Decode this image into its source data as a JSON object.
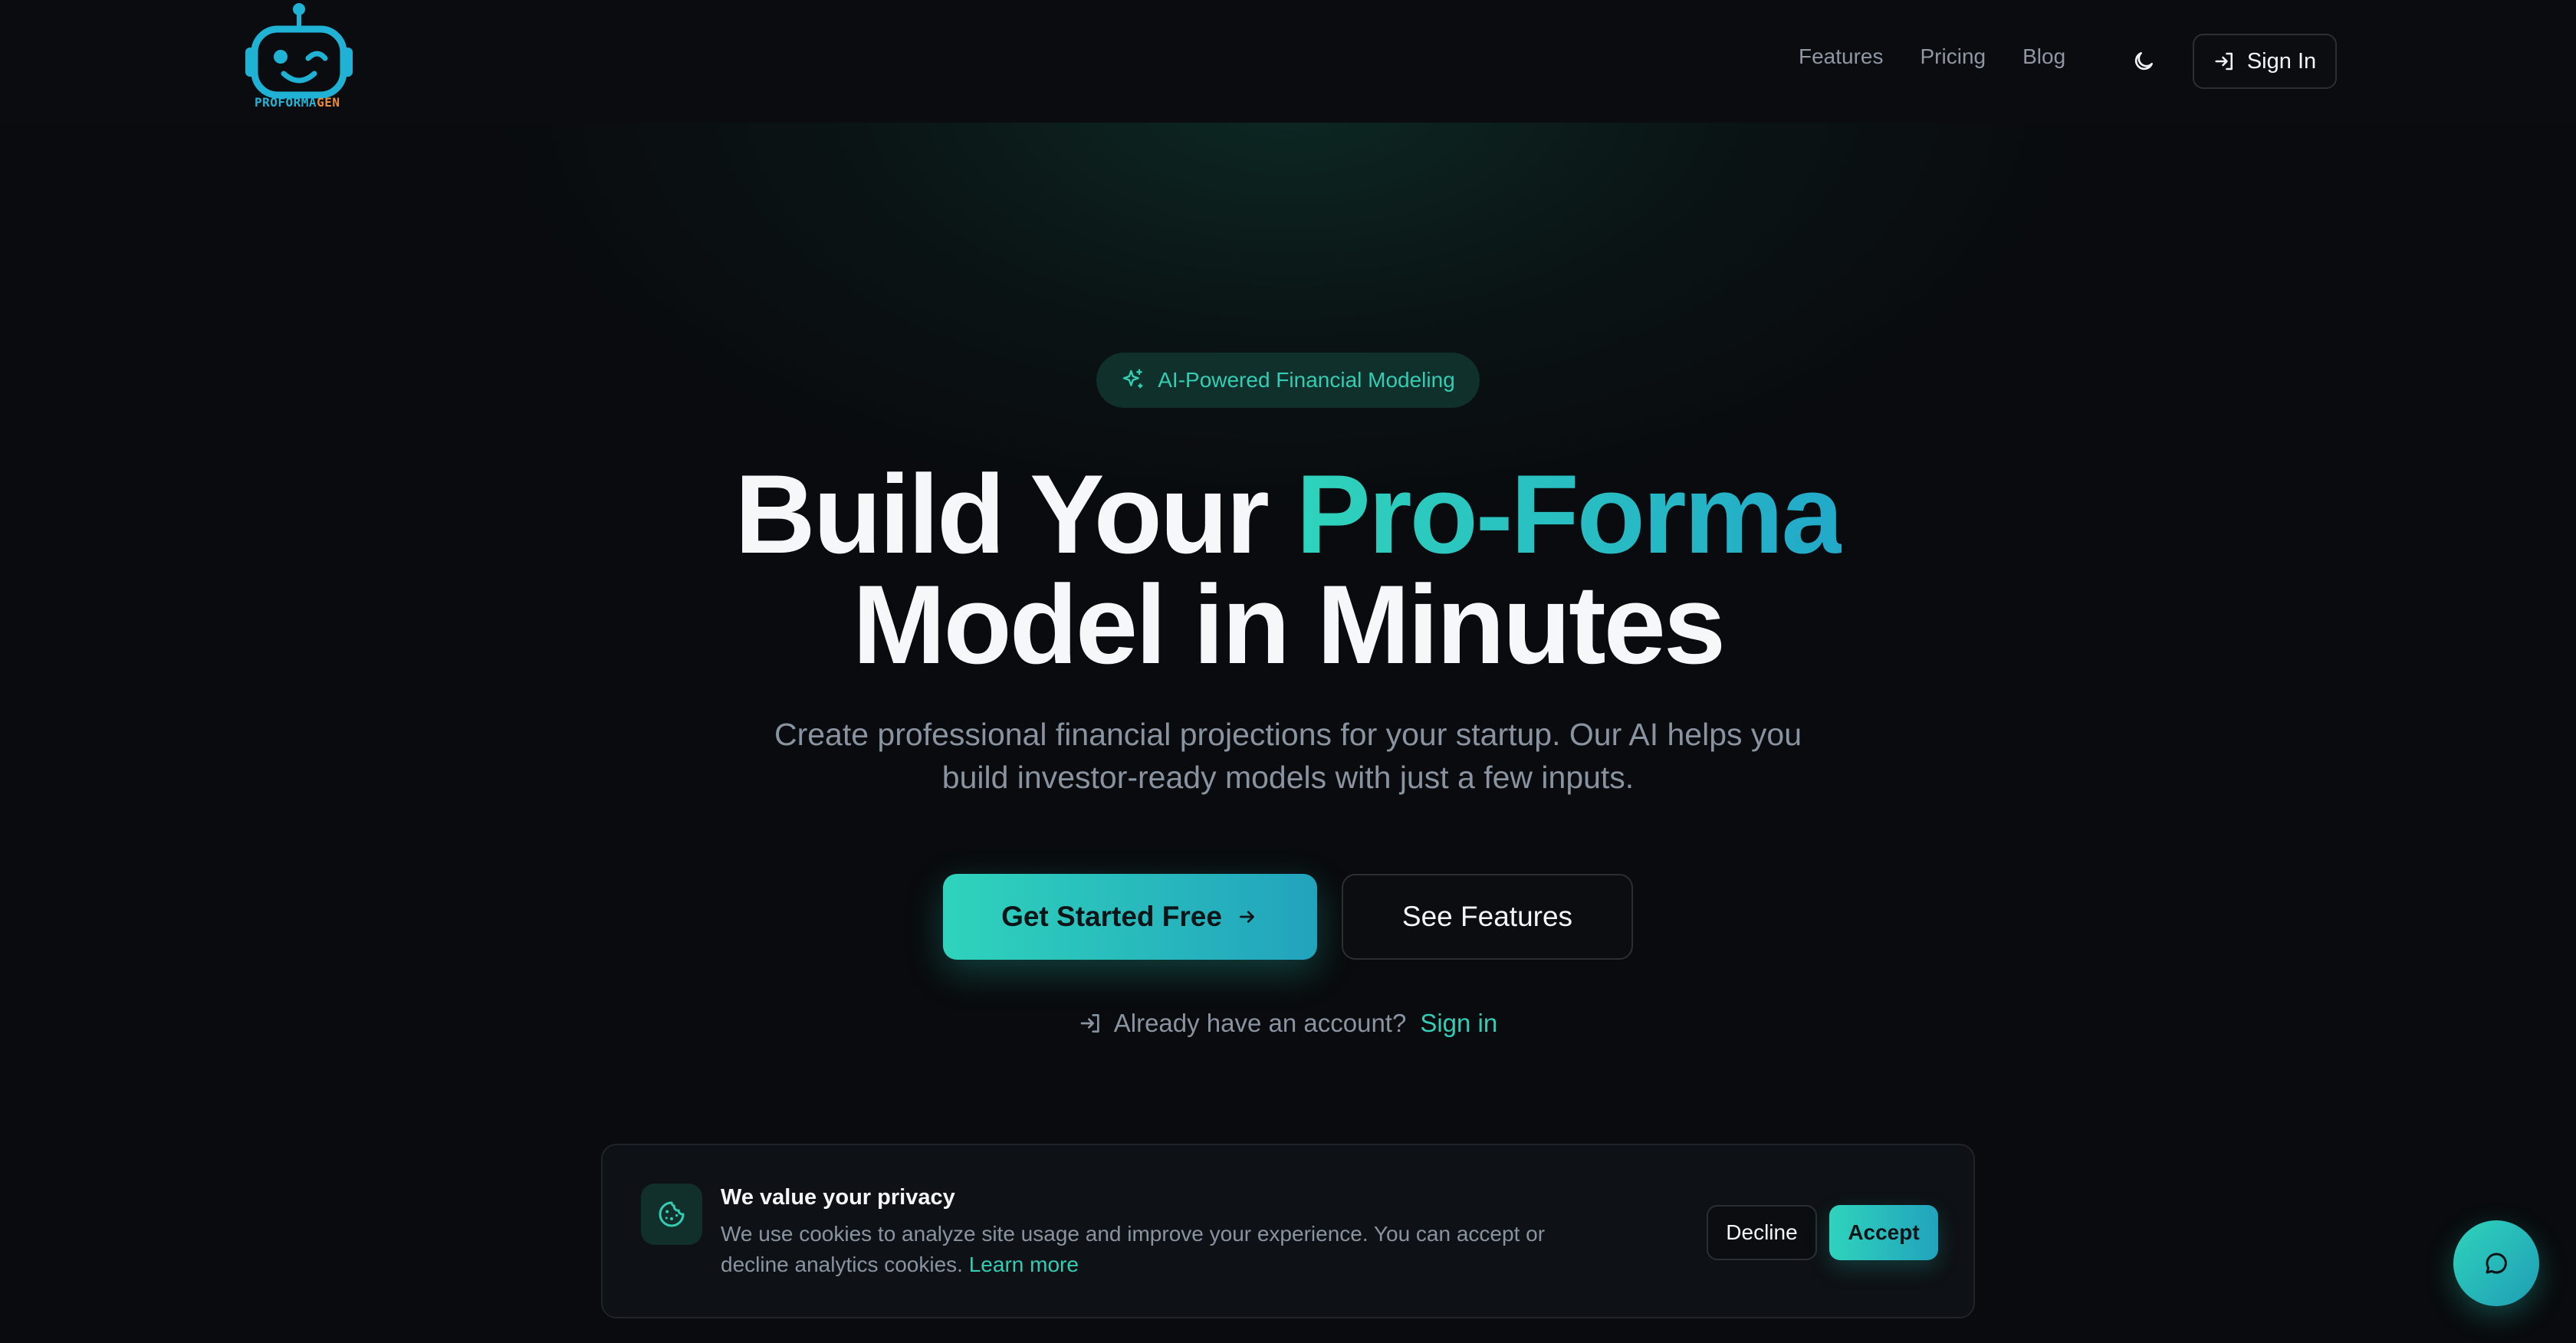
{
  "brand": {
    "name_a": "PROFORMA",
    "name_b": "GEN",
    "logo_icon": "robot-wink-icon"
  },
  "nav": {
    "items": [
      {
        "label": "Features"
      },
      {
        "label": "Pricing"
      },
      {
        "label": "Blog"
      }
    ]
  },
  "header": {
    "theme_icon": "moon-icon",
    "sign_in_label": "Sign In"
  },
  "hero": {
    "badge_label": "AI-Powered Financial Modeling",
    "title_part1": "Build Your ",
    "title_accent": "Pro-Forma",
    "title_line2": "Model in Minutes",
    "subtitle": "Create professional financial projections for your startup. Our AI helps you build investor-ready models with just a few inputs.",
    "cta_primary": "Get Started Free",
    "cta_secondary": "See Features",
    "account_prompt": "Already have an account?",
    "account_link": "Sign in"
  },
  "cookie": {
    "title": "We value your privacy",
    "body": "We use cookies to analyze site usage and improve your experience. You can accept or decline analytics cookies.",
    "learn_more": "Learn more",
    "decline": "Decline",
    "accept": "Accept"
  },
  "colors": {
    "accent": "#2fd3bc",
    "accent_end": "#22a3bd",
    "background": "#090b0e"
  }
}
